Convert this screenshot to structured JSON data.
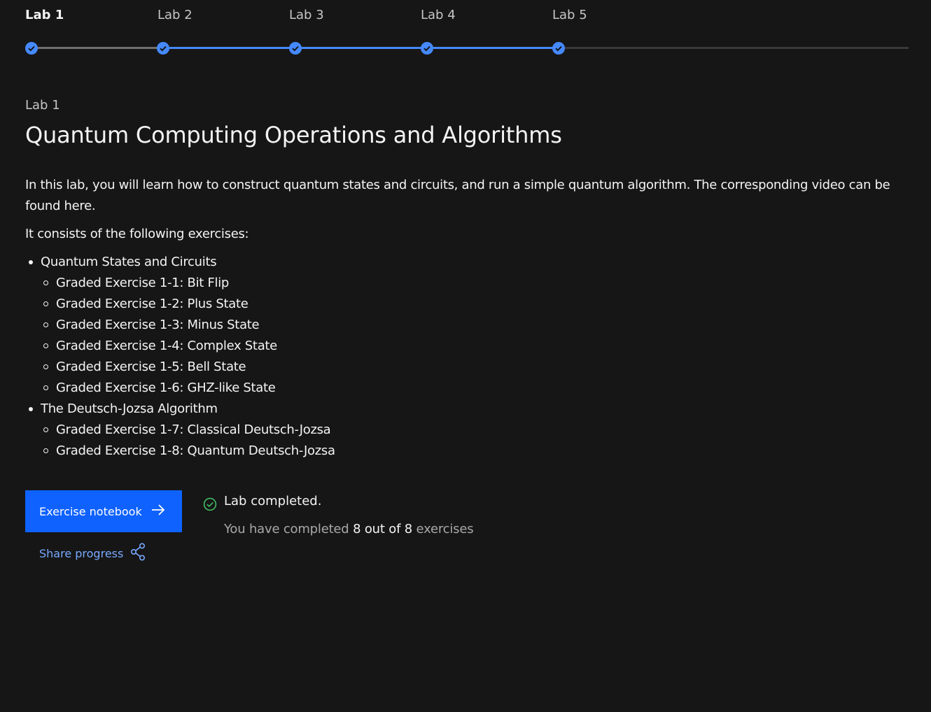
{
  "stepper": {
    "steps": [
      {
        "label": "Lab 1",
        "active": true,
        "completed": true
      },
      {
        "label": "Lab 2",
        "active": false,
        "completed": true
      },
      {
        "label": "Lab 3",
        "active": false,
        "completed": true
      },
      {
        "label": "Lab 4",
        "active": false,
        "completed": true
      },
      {
        "label": "Lab 5",
        "active": false,
        "completed": true
      }
    ],
    "accent_color": "#4589ff"
  },
  "lab": {
    "eyebrow": "Lab 1",
    "title": "Quantum Computing Operations and Algorithms",
    "intro": "In this lab, you will learn how to construct quantum states and circuits, and run a simple quantum algorithm. The corresponding video can be found here.",
    "exercises_heading": "It consists of the following exercises:",
    "groups": [
      {
        "label": "Quantum States and Circuits",
        "items": [
          "Graded Exercise 1-1: Bit Flip",
          "Graded Exercise 1-2: Plus State",
          "Graded Exercise 1-3: Minus State",
          "Graded Exercise 1-4: Complex State",
          "Graded Exercise 1-5: Bell State",
          "Graded Exercise 1-6: GHZ-like State"
        ]
      },
      {
        "label": "The Deutsch-Jozsa Algorithm",
        "items": [
          "Graded Exercise 1-7: Classical Deutsch-Jozsa",
          "Graded Exercise 1-8: Quantum Deutsch-Jozsa"
        ]
      }
    ]
  },
  "actions": {
    "notebook_label": "Exercise notebook",
    "notebook_icon": "arrow-right-icon",
    "share_label": "Share progress",
    "share_icon": "share-icon",
    "button_color": "#0f62fe",
    "link_color": "#78a9ff"
  },
  "status": {
    "icon": "checkmark-outline-icon",
    "icon_color": "#42be65",
    "title": "Lab completed.",
    "detail_prefix": "You have completed",
    "detail_count": "8 out of 8",
    "detail_suffix": "exercises"
  }
}
